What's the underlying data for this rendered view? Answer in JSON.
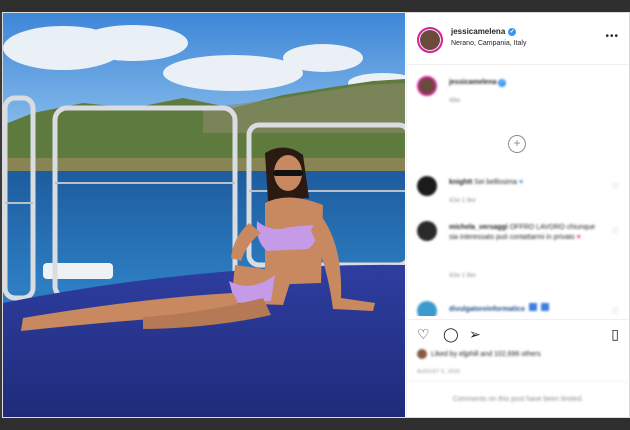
{
  "post": {
    "username": "jessicamelena",
    "location": "Nerano, Campania, Italy",
    "more_label": "•••"
  },
  "caption": {
    "username": "jessicamelena",
    "time": "48w"
  },
  "comments": [
    {
      "username": "knightt",
      "text": "Sei bellissima",
      "meta": "42w   1 like",
      "avatar_color": "#1b1b1b"
    },
    {
      "username": "michela_versaggi",
      "text": "OFFRO LAVORO chiunque sia interessato può contattarmi in privato",
      "meta": "42w   1 like",
      "avatar_color": "#2a2a2a"
    },
    {
      "username": "divulgatoreinformatico",
      "text": "",
      "meta": "",
      "avatar_color": "#3d9ad1"
    }
  ],
  "load_more_label": "+",
  "icons": {
    "like": "heart-icon",
    "comment": "comment-icon",
    "share": "share-icon",
    "save": "bookmark-icon"
  },
  "likes_text": "Liked by eljphill and 102,696 others",
  "date_text": "AUGUST 5, 2020",
  "comments_limited_text": "Comments on this post have been limited.",
  "colors": {
    "verified": "#3897f0",
    "story_ring": "#d6249f",
    "sea": "#2d7cc0",
    "deck": "#2a3590"
  }
}
